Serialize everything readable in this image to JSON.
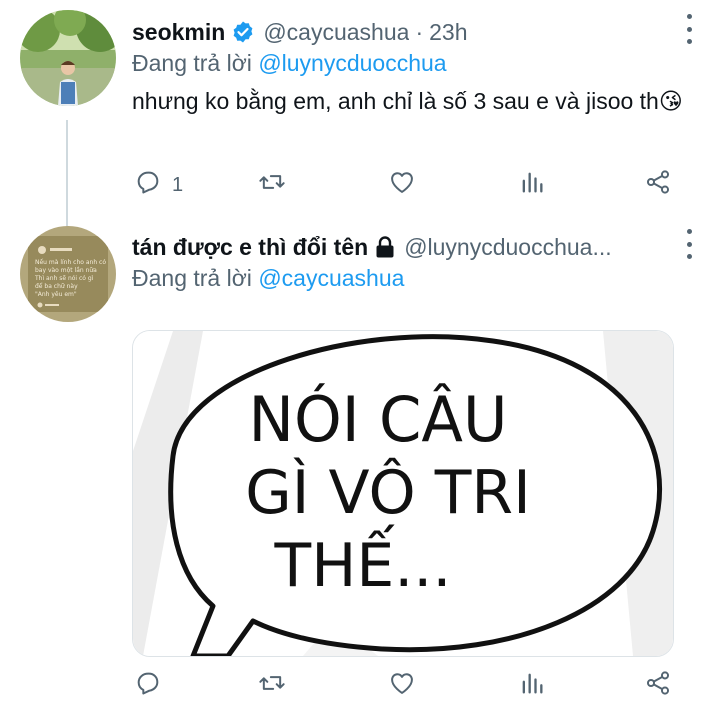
{
  "tweets": [
    {
      "name": "seokmin",
      "handle": "@caycuashua",
      "separator": "·",
      "time": "23h",
      "replying_prefix": "Đang trả lời",
      "replying_to": "@luynycduocchua",
      "text": "nhưng ko bằng em, anh chỉ là số 3 sau e và jisoo th😘",
      "reply_count": "1",
      "verified": true
    },
    {
      "name": "tán được e thì đổi tên",
      "handle": "@luynycduocchua...",
      "replying_prefix": "Đang trả lời",
      "replying_to": "@caycuashua",
      "locked": true,
      "media": {
        "type": "comic speech bubble",
        "lines": [
          "NÓI CÂU",
          "GÌ VÔ TRI",
          "THẾ..."
        ]
      },
      "avatar_lines": [
        "Nếu mà lính cho anh có",
        "bay vào một lần nữa",
        "Thì anh sẽ nói có gì",
        "để ba chữ này",
        "\"Anh yêu em\""
      ]
    }
  ],
  "icons": [
    "reply-icon",
    "retweet-icon",
    "like-icon",
    "analytics-icon",
    "share-icon",
    "more-icon",
    "verified-icon",
    "lock-icon"
  ],
  "colors": {
    "accent": "#1d9bf0",
    "secondary_text": "#536471",
    "thread_line": "#cfd9de"
  }
}
